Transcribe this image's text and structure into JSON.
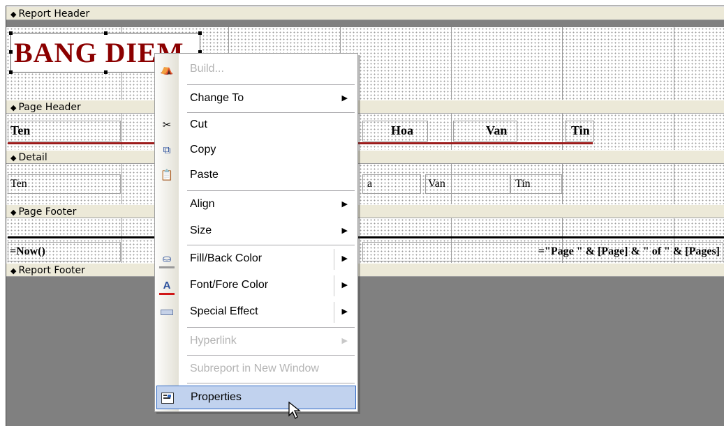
{
  "sections": {
    "report_header": "Report Header",
    "page_header": "Page Header",
    "detail": "Detail",
    "page_footer": "Page Footer",
    "report_footer": "Report Footer"
  },
  "report_header": {
    "title_label": "BANG DIEM"
  },
  "page_header": {
    "labels": [
      "Ten",
      "Hoa",
      "Van",
      "Tin"
    ]
  },
  "detail": {
    "textboxes": [
      "Ten",
      "a",
      "Van",
      "Tin"
    ]
  },
  "page_footer": {
    "date_expr": "=Now()",
    "page_expr": "=\"Page \" & [Page] & \" of \" & [Pages]"
  },
  "context_menu": {
    "items": [
      {
        "label": "Build...",
        "enabled": false,
        "icon": "build-icon"
      },
      {
        "label": "Change To",
        "enabled": true,
        "submenu": true
      },
      {
        "label": "Cut",
        "enabled": true,
        "icon": "scissors-icon"
      },
      {
        "label": "Copy",
        "enabled": true,
        "icon": "copy-icon"
      },
      {
        "label": "Paste",
        "enabled": true,
        "icon": "paste-icon"
      },
      {
        "label": "Align",
        "enabled": true,
        "submenu": true
      },
      {
        "label": "Size",
        "enabled": true,
        "submenu": true
      },
      {
        "label": "Fill/Back Color",
        "enabled": true,
        "submenu": true,
        "icon": "fill-color-icon"
      },
      {
        "label": "Font/Fore Color",
        "enabled": true,
        "submenu": true,
        "icon": "font-color-icon"
      },
      {
        "label": "Special Effect",
        "enabled": true,
        "submenu": true,
        "icon": "special-effect-icon"
      },
      {
        "label": "Hyperlink",
        "enabled": false,
        "submenu": true
      },
      {
        "label": "Subreport in New Window",
        "enabled": false
      },
      {
        "label": "Properties",
        "enabled": true,
        "icon": "properties-icon",
        "highlighted": true
      }
    ]
  },
  "colors": {
    "title": "#8b0000",
    "header_line": "#9b1b1b",
    "menu_highlight": "#c1d2ee"
  }
}
